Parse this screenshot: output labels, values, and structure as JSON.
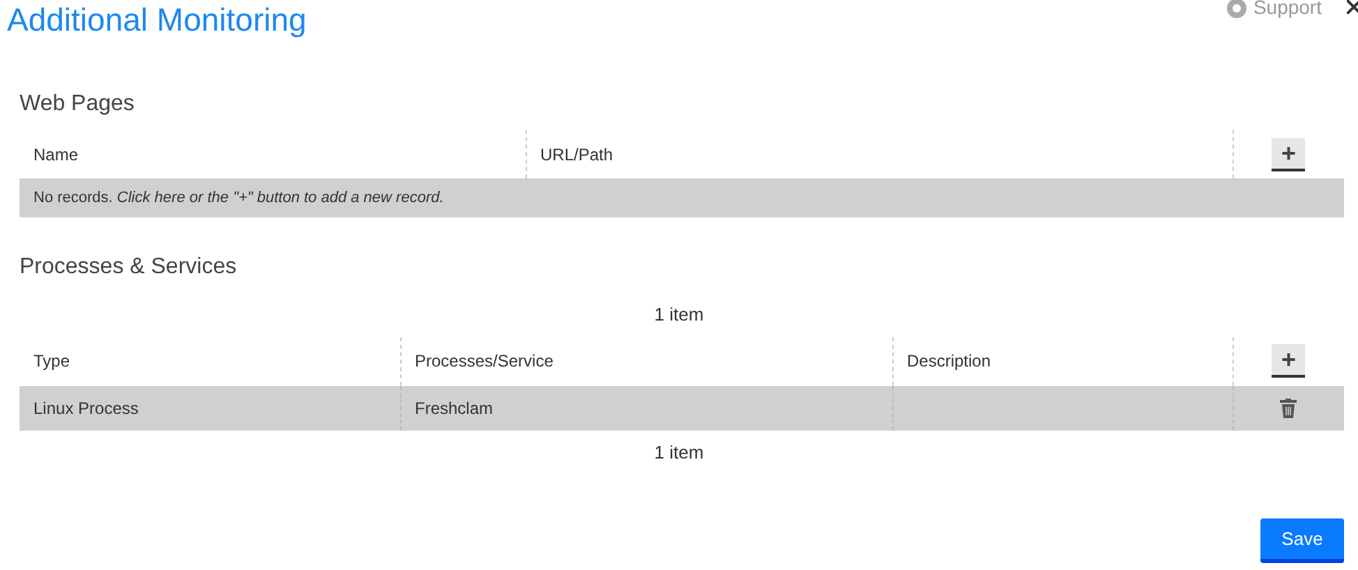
{
  "header": {
    "title": "Additional Monitoring",
    "support": "Support"
  },
  "web_pages": {
    "heading": "Web Pages",
    "columns": [
      "Name",
      "URL/Path"
    ],
    "add_button": "+",
    "empty_message": "No records. *Click here or the \"+\" button to add a new record.*"
  },
  "processes": {
    "heading": "Processes & Services",
    "count_top": "1 item",
    "columns": [
      "Type",
      "Processes/Service",
      "Description"
    ],
    "add_button": "+",
    "rows": [
      {
        "cells": [
          "Linux Process",
          "Freshclam",
          ""
        ]
      }
    ],
    "count_bottom": "1 item"
  },
  "save_button": "Save"
}
